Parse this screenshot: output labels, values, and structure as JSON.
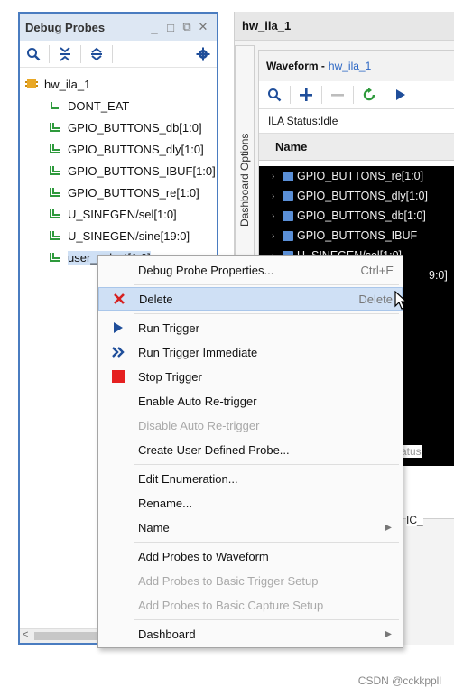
{
  "probes_panel": {
    "title": "Debug Probes",
    "window_buttons": [
      "_",
      "□",
      "⧉",
      "✕"
    ],
    "root": "hw_ila_1",
    "items": [
      "DONT_EAT",
      "GPIO_BUTTONS_db[1:0]",
      "GPIO_BUTTONS_dly[1:0]",
      "GPIO_BUTTONS_IBUF[1:0]",
      "GPIO_BUTTONS_re[1:0]",
      "U_SINEGEN/sel[1:0]",
      "U_SINEGEN/sine[19:0]",
      "user_select[1:0]"
    ]
  },
  "right_panel": {
    "tab_title": "hw_ila_1",
    "dashboard_label": "Dashboard Options",
    "waveform_title": "Waveform -",
    "waveform_link": "hw_ila_1",
    "ila_status": "ILA Status:Idle",
    "name_header": "Name",
    "signals": [
      "GPIO_BUTTONS_re[1:0]",
      "GPIO_BUTTONS_dly[1:0]",
      "GPIO_BUTTONS_db[1:0]",
      "GPIO_BUTTONS_IBUF",
      "U_SINEGEN/sel[1:0]"
    ],
    "peek_text_1": "9:0]",
    "peek_text_2": "atus",
    "peek_text_3": "IC_"
  },
  "context_menu": {
    "items": [
      {
        "label": "Debug Probe Properties...",
        "shortcut": "Ctrl+E",
        "icon": "",
        "disabled": false
      },
      {
        "label": "Delete",
        "shortcut": "Delete",
        "icon": "x-icon",
        "disabled": false,
        "highlighted": true
      },
      {
        "label": "Run Trigger",
        "shortcut": "",
        "icon": "play-icon",
        "disabled": false
      },
      {
        "label": "Run Trigger Immediate",
        "shortcut": "",
        "icon": "double-chevron-icon",
        "disabled": false
      },
      {
        "label": "Stop Trigger",
        "shortcut": "",
        "icon": "stop-icon",
        "disabled": false
      },
      {
        "label": "Enable Auto Re-trigger",
        "shortcut": "",
        "icon": "",
        "disabled": false
      },
      {
        "label": "Disable Auto Re-trigger",
        "shortcut": "",
        "icon": "",
        "disabled": true
      },
      {
        "label": "Create User Defined Probe...",
        "shortcut": "",
        "icon": "",
        "disabled": false
      },
      {
        "label": "Edit Enumeration...",
        "shortcut": "",
        "icon": "",
        "disabled": false
      },
      {
        "label": "Rename...",
        "shortcut": "",
        "icon": "",
        "disabled": false
      },
      {
        "label": "Name",
        "shortcut": "",
        "icon": "",
        "disabled": false,
        "submenu": true
      },
      {
        "label": "Add Probes to Waveform",
        "shortcut": "",
        "icon": "",
        "disabled": false
      },
      {
        "label": "Add Probes to Basic Trigger Setup",
        "shortcut": "",
        "icon": "",
        "disabled": true
      },
      {
        "label": "Add Probes to Basic Capture Setup",
        "shortcut": "",
        "icon": "",
        "disabled": true
      },
      {
        "label": "Dashboard",
        "shortcut": "",
        "icon": "",
        "disabled": false,
        "submenu": true
      }
    ]
  },
  "colors": {
    "panel_border": "#4a7cc0",
    "highlight": "#cfe0f5",
    "delete_red": "#d62020",
    "run_blue": "#1f4e9a",
    "stop_red": "#e52020",
    "probe_green": "#2e9a3c"
  },
  "watermark": "CSDN @cckkppll"
}
